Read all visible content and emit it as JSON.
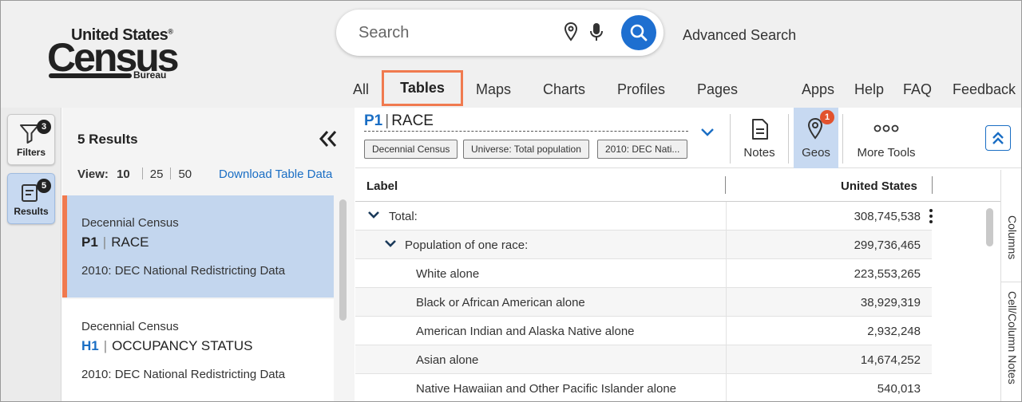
{
  "brand": {
    "line1": "United States",
    "line2": "Census",
    "line3": "Bureau"
  },
  "search": {
    "placeholder": "Search",
    "advanced": "Advanced Search"
  },
  "nav": {
    "all": "All",
    "tables": "Tables",
    "maps": "Maps",
    "charts": "Charts",
    "profiles": "Profiles",
    "pages": "Pages",
    "apps": "Apps",
    "help": "Help",
    "faq": "FAQ",
    "feedback": "Feedback"
  },
  "rail": {
    "filters": {
      "label": "Filters",
      "badge": "3"
    },
    "results": {
      "label": "Results",
      "badge": "5"
    }
  },
  "results_panel": {
    "count": "5 Results",
    "view_label": "View:",
    "view_options": [
      "10",
      "25",
      "50"
    ],
    "download": "Download Table Data",
    "items": [
      {
        "source": "Decennial Census",
        "code": "P1",
        "title": "RACE",
        "dataset": "2010: DEC National Redistricting Data"
      },
      {
        "source": "Decennial Census",
        "code": "H1",
        "title": "OCCUPANCY STATUS",
        "dataset": "2010: DEC National Redistricting Data"
      }
    ]
  },
  "table": {
    "code": "P1",
    "title": "RACE",
    "chips": [
      "Decennial Census",
      "Universe: Total population",
      "2010: DEC Nati..."
    ],
    "tools": {
      "notes": "Notes",
      "geos": "Geos",
      "geos_badge": "1",
      "more": "More Tools"
    },
    "headers": {
      "label": "Label",
      "geo": "United States"
    },
    "rows": [
      {
        "label": "Total:",
        "value": "308,745,538"
      },
      {
        "label": "Population of one race:",
        "value": "299,736,465"
      },
      {
        "label": "White alone",
        "value": "223,553,265"
      },
      {
        "label": "Black or African American alone",
        "value": "38,929,319"
      },
      {
        "label": "American Indian and Alaska Native alone",
        "value": "2,932,248"
      },
      {
        "label": "Asian alone",
        "value": "14,674,252"
      },
      {
        "label": "Native Hawaiian and Other Pacific Islander alone",
        "value": "540,013"
      }
    ],
    "side_tabs": [
      "Columns",
      "Cell/Column Notes"
    ]
  },
  "colors": {
    "accent": "#1e6fd0",
    "highlight": "#f07a4f",
    "selected": "#c3d6ee",
    "badge_red": "#e2522e"
  }
}
